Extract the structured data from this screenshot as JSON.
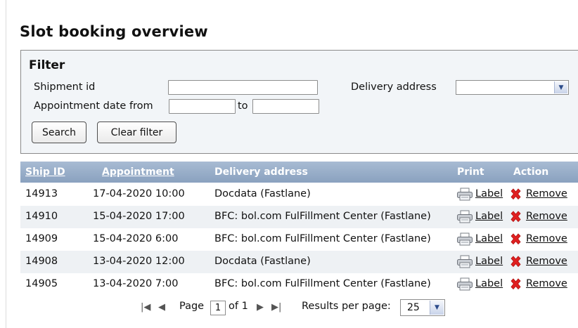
{
  "page": {
    "title": "Slot booking overview"
  },
  "filter": {
    "title": "Filter",
    "shipment_id_label": "Shipment id",
    "shipment_id_value": "",
    "delivery_address_label": "Delivery address",
    "delivery_address_value": "",
    "appointment_from_label": "Appointment date from",
    "appointment_from_value": "",
    "to_label": "to",
    "appointment_to_value": "",
    "search_label": "Search",
    "clear_label": "Clear filter"
  },
  "table": {
    "headers": {
      "ship_id": "Ship ID",
      "appointment": "Appointment",
      "delivery_address": "Delivery address",
      "print": "Print",
      "action": "Action"
    },
    "rows": [
      {
        "ship_id": "14913",
        "appointment": "17-04-2020 10:00",
        "delivery_address": "Docdata (Fastlane)",
        "print": "Label",
        "action": "Remove"
      },
      {
        "ship_id": "14910",
        "appointment": "15-04-2020 17:00",
        "delivery_address": "BFC: bol.com FulFillment Center (Fastlane)",
        "print": "Label",
        "action": "Remove"
      },
      {
        "ship_id": "14909",
        "appointment": "15-04-2020 6:00",
        "delivery_address": "BFC: bol.com FulFillment Center (Fastlane)",
        "print": "Label",
        "action": "Remove"
      },
      {
        "ship_id": "14908",
        "appointment": "13-04-2020 12:00",
        "delivery_address": "Docdata (Fastlane)",
        "print": "Label",
        "action": "Remove"
      },
      {
        "ship_id": "14905",
        "appointment": "13-04-2020 7:00",
        "delivery_address": "BFC: bol.com FulFillment Center (Fastlane)",
        "print": "Label",
        "action": "Remove"
      }
    ]
  },
  "pager": {
    "page_label": "Page",
    "page_value": "1",
    "of_label": "of 1",
    "results_label": "Results per page:",
    "results_value": "25"
  },
  "colors": {
    "header_bg": "#8fa5c1",
    "filter_bg": "#f2f5f8",
    "remove_icon": "#e02020"
  }
}
